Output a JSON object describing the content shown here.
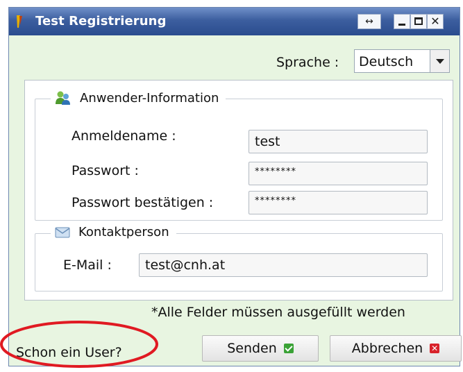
{
  "window": {
    "title": "Test Registrierung"
  },
  "titlebar_buttons": {
    "resize": "↔",
    "close": "✕"
  },
  "language": {
    "label": "Sprache :",
    "value": "Deutsch"
  },
  "user_info": {
    "legend": "Anwender-Information",
    "icon": "users-icon",
    "username_label": "Anmeldename :",
    "username_value": "test",
    "password_label": "Passwort :",
    "password_value": "********",
    "confirm_label": "Passwort bestätigen :",
    "confirm_value": "********"
  },
  "contact": {
    "legend": "Kontaktperson",
    "icon": "envelope-icon",
    "email_label": "E-Mail :",
    "email_value": "test@cnh.at"
  },
  "note": "*Alle Felder müssen ausgefüllt werden",
  "footer": {
    "existing_user": "Schon ein User?",
    "send_label": "Senden",
    "cancel_label": "Abbrechen"
  },
  "colors": {
    "window_bg": "#e8f5e1",
    "titlebar": "#3c5e9f",
    "annotation": "#e01a22",
    "ok": "#3aa236",
    "cancel": "#d8222a"
  }
}
